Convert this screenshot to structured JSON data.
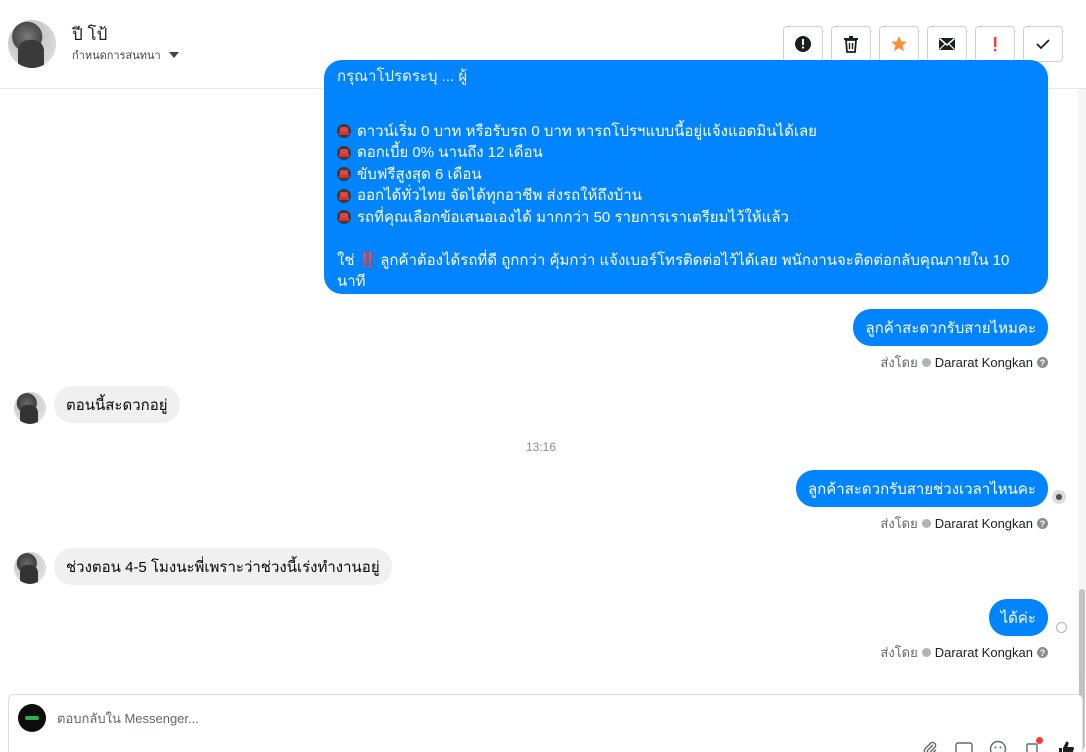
{
  "header": {
    "contact_name": "ปี โป้",
    "subtitle": "กำหนดการสนทนา",
    "actions": [
      {
        "name": "mark-spam",
        "icon": "alert-circle-icon"
      },
      {
        "name": "delete",
        "icon": "trash-icon"
      },
      {
        "name": "star",
        "icon": "star-icon",
        "color": "#f7923b"
      },
      {
        "name": "mark-unread",
        "icon": "envelope-icon"
      },
      {
        "name": "follow-up",
        "icon": "exclamation-icon",
        "color": "#fa383e"
      },
      {
        "name": "mark-done",
        "icon": "check-icon"
      }
    ]
  },
  "messages": {
    "big": {
      "cut_line": "กรุณาโปรดระบุ ... ผู้",
      "bullets": [
        "ดาวน์เริ่ม 0 บาท หรือรับรถ 0 บาท หารถโปรฯแบบนี้อยู่แจ้งแอดมินได้เลย",
        "ดอกเบี้ย 0% นานถึง 12 เดือน",
        "ขับฟรีสูงสุด 6 เดือน",
        "ออกได้ทั่วไทย จัดได้ทุกอาชีพ ส่งรถให้ถึงบ้าน",
        "รถที่คุณเลือกข้อเสนอเองได้ มากกว่า 50 รายการเราเตรียมไว้ให้แล้ว"
      ],
      "closing_prefix": "ใช่",
      "closing_bang": "‼️",
      "closing_text": "ลูกค้าต้องได้รถที่ดี ถูกกว่า คุ้มกว่า แจ้งเบอร์โทรติดต่อไว้ได้เลย พนักงานจะติดต่อกลับคุณภายใน 10",
      "closing_text2": "นาที"
    },
    "m1": "ลูกค้าสะดวกรับสายไหมคะ",
    "m2": "ตอนนี้สะดวกอยู่",
    "timestamp": "13:16",
    "m3": "ลูกค้าสะดวกรับสายช่วงเวลาไหนคะ",
    "m4": "ช่วงตอน 4-5 โมงนะพี่เพราะว่าช่วงนี้เร่งทำงานอยู่",
    "m5": "ได้ค่ะ",
    "sent_by_label": "ส่งโดย",
    "sender_name": "Dararat Kongkan"
  },
  "composer": {
    "placeholder": "ตอบกลับใน Messenger...",
    "icons": [
      "paperclip-icon",
      "gif-icon",
      "emoji-icon",
      "saved-reply-icon",
      "thumbs-up-icon"
    ]
  },
  "colors": {
    "outgoing": "#0084ff",
    "incoming": "#f0f0f0",
    "star": "#f7923b",
    "alert": "#fa383e"
  }
}
